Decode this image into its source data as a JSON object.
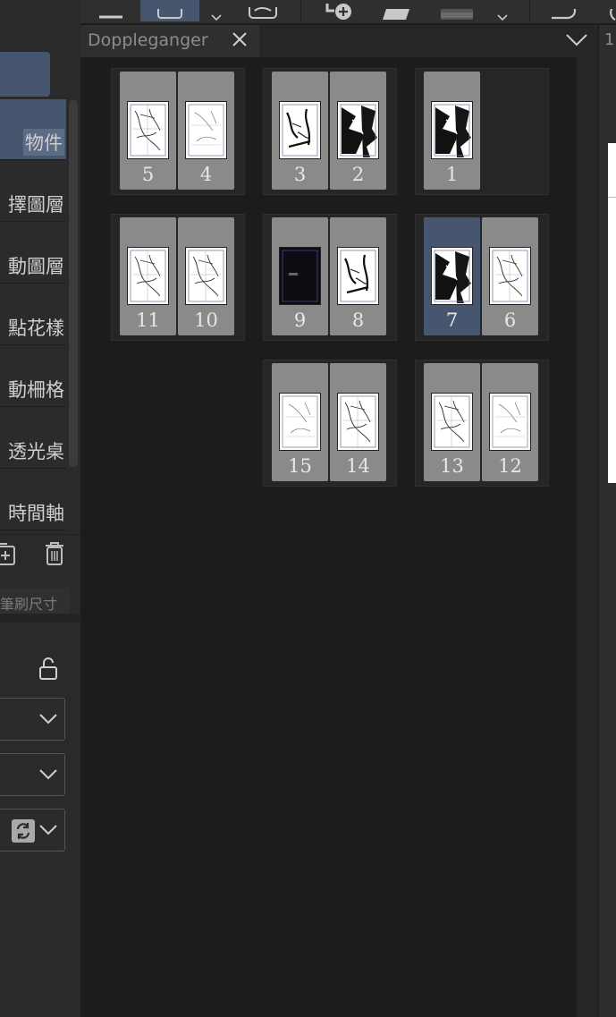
{
  "panel": {
    "title": "Doppleganger"
  },
  "sidebar": {
    "items": [
      {
        "label": "物件",
        "active": true
      },
      {
        "label": "擇圖層"
      },
      {
        "label": "動圖層"
      },
      {
        "label": "點花樣"
      },
      {
        "label": "動柵格"
      },
      {
        "label": "透光桌"
      },
      {
        "label": "時間軸"
      }
    ]
  },
  "tool_property": {
    "tab_label": "筆刷尺寸"
  },
  "right_edge": {
    "label": "1"
  },
  "pages": [
    {
      "number": "5",
      "style": "line"
    },
    {
      "number": "4",
      "style": "light"
    },
    {
      "number": "3",
      "style": "ink"
    },
    {
      "number": "2",
      "style": "heavy"
    },
    {
      "number": "1",
      "style": "heavy"
    },
    {
      "number": "11",
      "style": "line"
    },
    {
      "number": "10",
      "style": "line"
    },
    {
      "number": "9",
      "style": "dark"
    },
    {
      "number": "8",
      "style": "ink"
    },
    {
      "number": "7",
      "style": "heavy",
      "selected": true
    },
    {
      "number": "6",
      "style": "line"
    },
    {
      "number": "15",
      "style": "light"
    },
    {
      "number": "14",
      "style": "line"
    },
    {
      "number": "13",
      "style": "line"
    },
    {
      "number": "12",
      "style": "light"
    }
  ],
  "colors": {
    "accent": "#46566f",
    "page_bg": "#8a8a8a",
    "panel_bg": "#1c1c1c"
  }
}
